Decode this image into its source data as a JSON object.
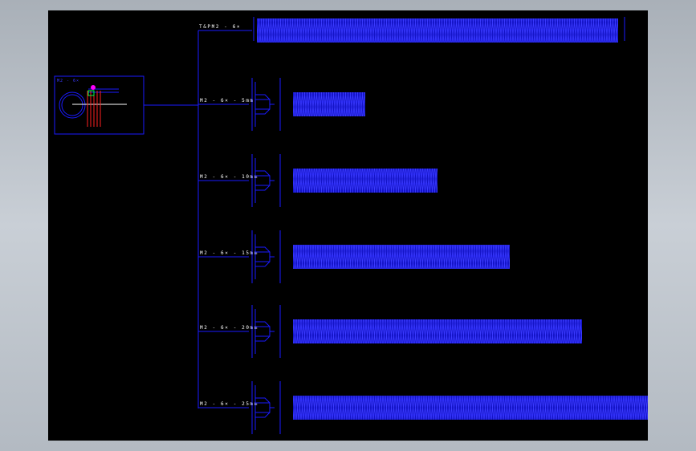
{
  "drawing": {
    "background": "#000000",
    "line_color": "#1a1aff",
    "thread_color": "#2323ff",
    "master_label": "T&PM2 - 6×",
    "assembly_view_label": "M2 - 6×",
    "rods": [
      {
        "label": "M2 - 6× - 5mm",
        "length_mm": 5
      },
      {
        "label": "M2 - 6× - 10mm",
        "length_mm": 10
      },
      {
        "label": "M2 - 6× - 15mm",
        "length_mm": 15
      },
      {
        "label": "M2 - 6× - 20mm",
        "length_mm": 20
      },
      {
        "label": "M2 - 6× - 25mm",
        "length_mm": 25
      }
    ]
  }
}
